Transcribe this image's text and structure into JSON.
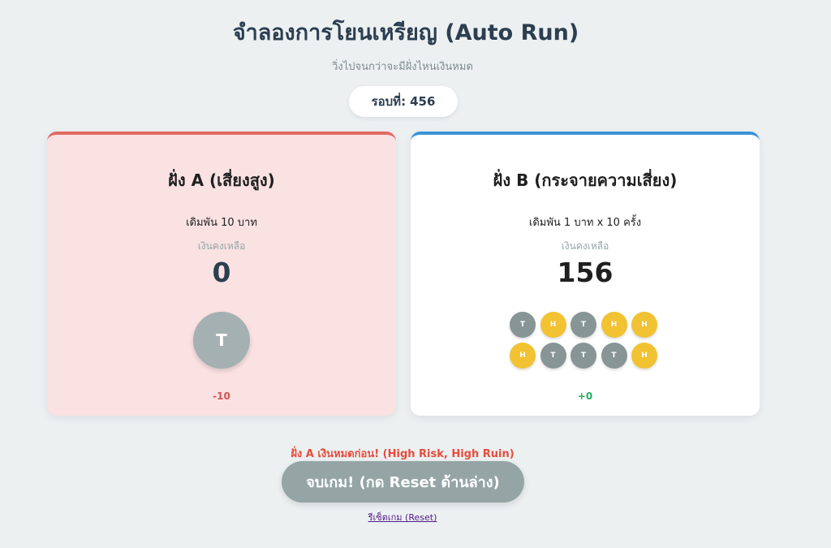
{
  "header": {
    "title": "จำลองการโยนเหรียญ (Auto Run)",
    "subtitle": "วิ่งไปจนกว่าจะมีฝั่งไหนเงินหมด"
  },
  "round": {
    "label": "รอบที่:",
    "value": "456"
  },
  "side_a": {
    "title": "ฝั่ง A (เสี่ยงสูง)",
    "bet": "เดิมพัน 10 บาท",
    "balance_label": "เงินคงเหลือ",
    "balance": "0",
    "coin": "T",
    "delta": "-10",
    "accent_color": "#e16b60"
  },
  "side_b": {
    "title": "ฝั่ง B (กระจายความเสี่ยง)",
    "bet": "เดิมพัน 1 บาท x 10 ครั้ง",
    "balance_label": "เงินคงเหลือ",
    "balance": "156",
    "coins": [
      "T",
      "H",
      "T",
      "H",
      "H",
      "H",
      "T",
      "T",
      "T",
      "H"
    ],
    "delta": "+0",
    "accent_color": "#3b93d6"
  },
  "result": {
    "message": "ฝั่ง A เงินหมดก่อน! (High Risk, High Ruin)",
    "end_button": "จบเกม! (กด Reset ด้านล่าง)",
    "reset_link": "รีเซ็ตเกม (Reset)"
  }
}
